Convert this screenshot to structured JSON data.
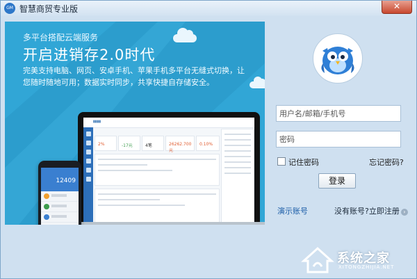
{
  "window": {
    "title": "智慧商贸专业版",
    "icon_text": "GM",
    "close_label": "✕"
  },
  "banner": {
    "subtitle": "多平台搭配云端服务",
    "headline": "开启进销存2.0时代",
    "description": "完美支持电脑、网页、安卓手机、苹果手机多平台无缝式切换，让您随时随地可用；数据实时同步，共享快捷自存储安全。",
    "phone_number": "12409",
    "laptop_kpis": [
      "2%",
      "-17元",
      "4笔",
      "26262.700元",
      "0.10%"
    ]
  },
  "login": {
    "username_placeholder": "用户名/邮箱/手机号",
    "password_placeholder": "密码",
    "remember_label": "记住密码",
    "forgot_label": "忘记密码?",
    "login_button": "登录",
    "demo_label": "演示账号",
    "register_label": "没有账号?立即注册"
  },
  "watermark": {
    "text": "系统之家",
    "sub": "XITONGZHIJIA.NET"
  },
  "colors": {
    "banner_bg": "#31a6d6",
    "panel_bg": "#cfe0f0",
    "link": "#1c5ea8",
    "owl_blue": "#2f7fd6"
  }
}
